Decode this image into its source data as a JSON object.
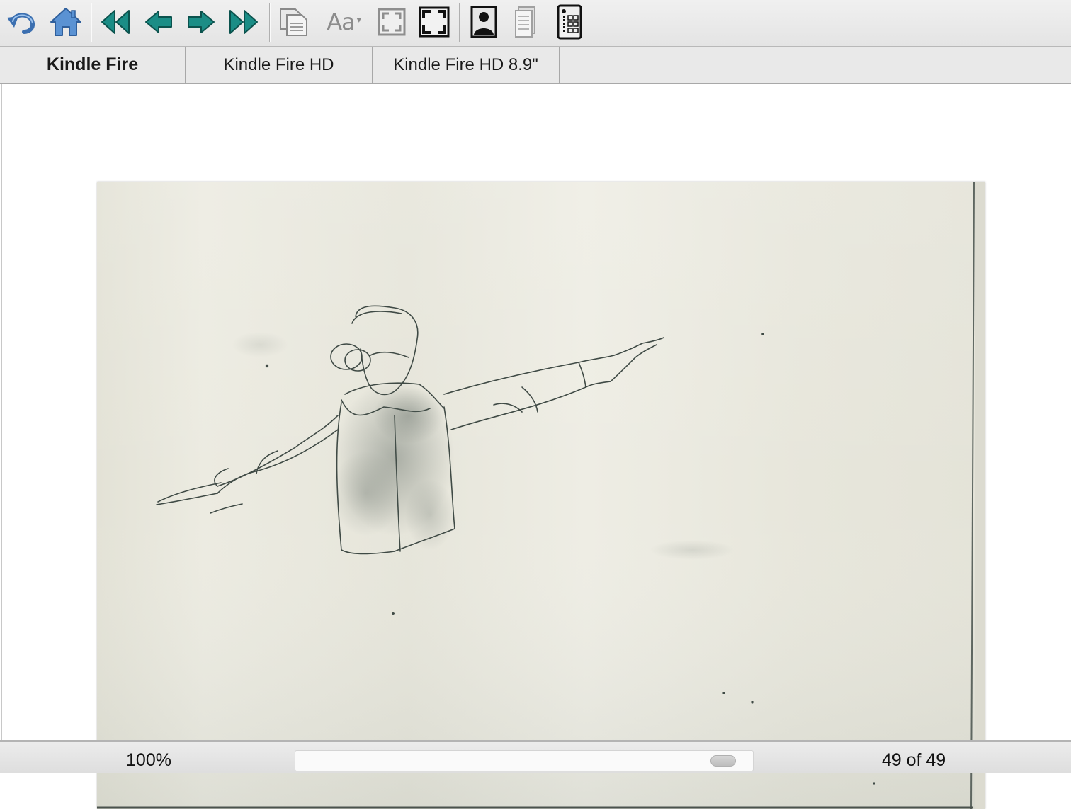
{
  "toolbar": {
    "buttons": [
      {
        "name": "undo-icon"
      },
      {
        "name": "home-icon"
      },
      {
        "name": "first-page-icon"
      },
      {
        "name": "previous-page-icon"
      },
      {
        "name": "next-page-icon"
      },
      {
        "name": "last-page-icon"
      },
      {
        "name": "copy-pages-icon"
      },
      {
        "name": "font-size-icon"
      },
      {
        "name": "fit-page-icon"
      },
      {
        "name": "actual-size-icon"
      },
      {
        "name": "portrait-orientation-icon"
      },
      {
        "name": "document-view-icon"
      },
      {
        "name": "device-info-icon"
      }
    ],
    "font_button_label": "Aa",
    "font_button_caret": "▾"
  },
  "tabs": [
    {
      "label": "Kindle Fire",
      "active": true
    },
    {
      "label": "Kindle Fire HD",
      "active": false
    },
    {
      "label": "Kindle Fire HD 8.9\"",
      "active": false
    }
  ],
  "viewer": {
    "image": {
      "subject": "pencil-sketch",
      "paper_color": "#e9e8dd",
      "ink_color": "#3f4a45"
    }
  },
  "status": {
    "zoom": "100%",
    "page_counter": "49 of 49",
    "progress": 0.967
  },
  "colors": {
    "nav_teal": "#1b8d86",
    "home_blue": "#4d86c8"
  }
}
